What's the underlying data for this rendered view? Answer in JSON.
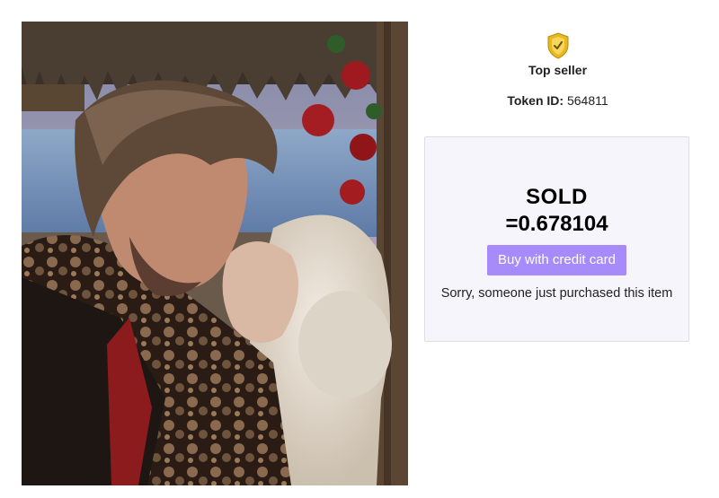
{
  "artwork": {
    "alt": "Virtual couple kissing under a thatched gazebo by the sea"
  },
  "seller": {
    "badge_icon": "shield-check-icon",
    "label": "Top seller"
  },
  "token": {
    "label": "Token ID:",
    "value": "564811"
  },
  "sale": {
    "status": "SOLD",
    "price": "=0.678104",
    "buy_button": "Buy with credit card",
    "notice": "Sorry, someone just purchased this item"
  },
  "colors": {
    "accent": "#a78bfa",
    "panel_bg": "#f5f5fb",
    "shield_gold": "#e8b820"
  }
}
